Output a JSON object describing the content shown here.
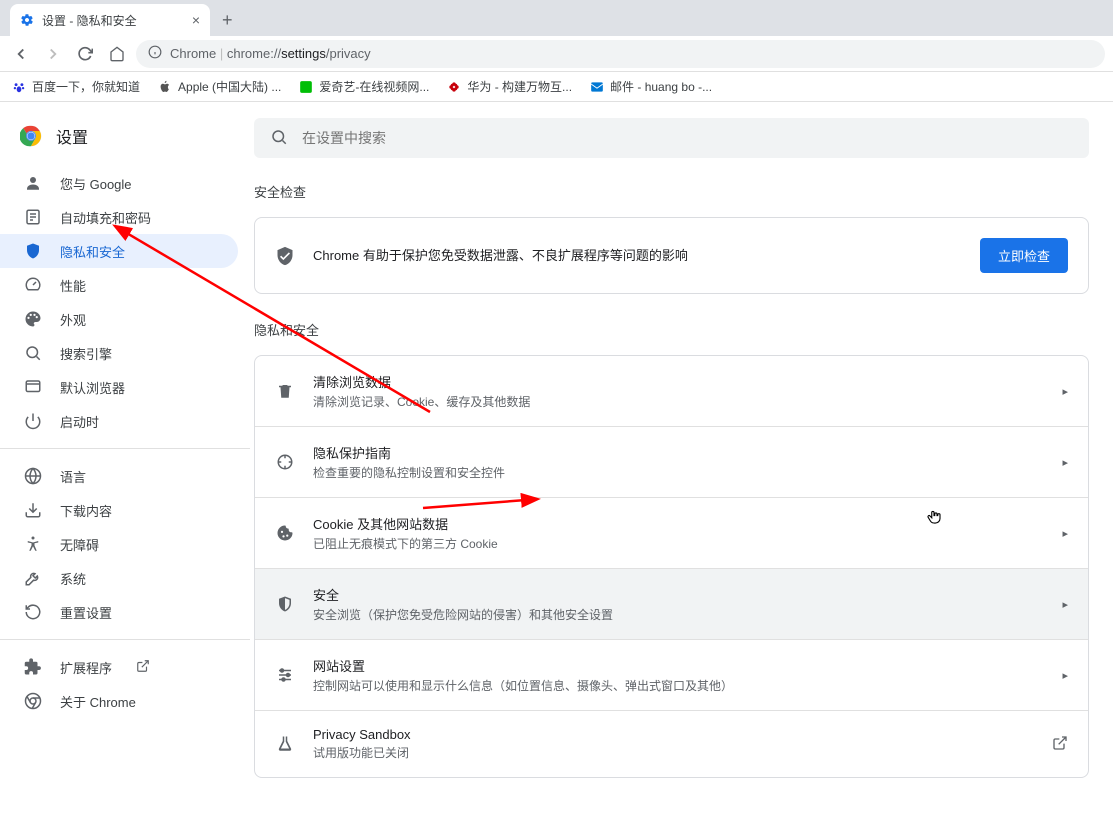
{
  "tab": {
    "title": "设置 - 隐私和安全"
  },
  "address": {
    "protocol": "Chrome",
    "host": "chrome://",
    "path_bold": "settings",
    "path_rest": "/privacy"
  },
  "bookmarks": [
    {
      "label": "百度一下，你就知道",
      "icon": "paw",
      "color": "#2932e1"
    },
    {
      "label": "Apple (中国大陆) ...",
      "icon": "apple",
      "color": "#555"
    },
    {
      "label": "爱奇艺-在线视频网...",
      "icon": "square",
      "color": "#00be06"
    },
    {
      "label": "华为 - 构建万物互...",
      "icon": "flower",
      "color": "#c7000b"
    },
    {
      "label": "邮件 - huang bo -...",
      "icon": "mail",
      "color": "#0078d4"
    }
  ],
  "settings_title": "设置",
  "sidebar": {
    "items1": [
      {
        "icon": "person",
        "label": "您与 Google"
      },
      {
        "icon": "autofill",
        "label": "自动填充和密码"
      },
      {
        "icon": "shield",
        "label": "隐私和安全",
        "active": true
      },
      {
        "icon": "speed",
        "label": "性能"
      },
      {
        "icon": "palette",
        "label": "外观"
      },
      {
        "icon": "search",
        "label": "搜索引擎"
      },
      {
        "icon": "browser",
        "label": "默认浏览器"
      },
      {
        "icon": "power",
        "label": "启动时"
      }
    ],
    "items2": [
      {
        "icon": "globe",
        "label": "语言"
      },
      {
        "icon": "download",
        "label": "下载内容"
      },
      {
        "icon": "accessibility",
        "label": "无障碍"
      },
      {
        "icon": "wrench",
        "label": "系统"
      },
      {
        "icon": "reset",
        "label": "重置设置"
      }
    ],
    "items3": [
      {
        "icon": "extension",
        "label": "扩展程序",
        "external": true
      },
      {
        "icon": "chrome",
        "label": "关于 Chrome"
      }
    ]
  },
  "search": {
    "placeholder": "在设置中搜索"
  },
  "safety": {
    "section": "安全检查",
    "text": "Chrome 有助于保护您免受数据泄露、不良扩展程序等问题的影响",
    "button": "立即检查"
  },
  "privacy": {
    "section": "隐私和安全",
    "rows": [
      {
        "icon": "trash",
        "title": "清除浏览数据",
        "desc": "清除浏览记录、Cookie、缓存及其他数据"
      },
      {
        "icon": "target",
        "title": "隐私保护指南",
        "desc": "检查重要的隐私控制设置和安全控件"
      },
      {
        "icon": "cookie",
        "title": "Cookie 及其他网站数据",
        "desc": "已阻止无痕模式下的第三方 Cookie"
      },
      {
        "icon": "shield",
        "title": "安全",
        "desc": "安全浏览（保护您免受危险网站的侵害）和其他安全设置",
        "highlight": true
      },
      {
        "icon": "tune",
        "title": "网站设置",
        "desc": "控制网站可以使用和显示什么信息（如位置信息、摄像头、弹出式窗口及其他）"
      },
      {
        "icon": "flask",
        "title": "Privacy Sandbox",
        "desc": "试用版功能已关闭",
        "launch": true
      }
    ]
  }
}
